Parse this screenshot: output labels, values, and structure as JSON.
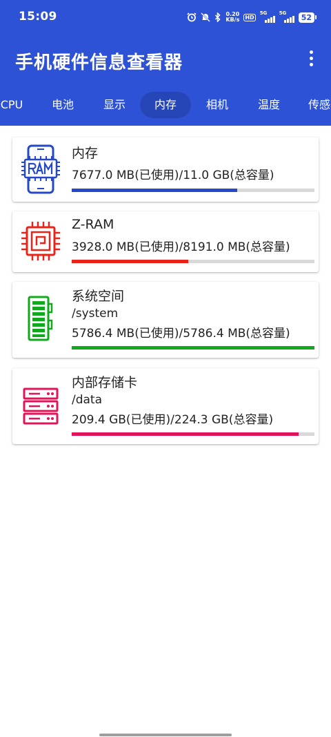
{
  "status_bar": {
    "time": "15:09",
    "net_speed_value": "0.20",
    "net_speed_unit": "KB/s",
    "hd_badge": "HD",
    "signal1_label": "5G",
    "signal2_label": "5G",
    "battery": "52"
  },
  "app": {
    "title": "手机硬件信息查看器"
  },
  "tabs": [
    {
      "label": "CPU",
      "active": false
    },
    {
      "label": "电池",
      "active": false
    },
    {
      "label": "显示",
      "active": false
    },
    {
      "label": "内存",
      "active": true
    },
    {
      "label": "相机",
      "active": false
    },
    {
      "label": "温度",
      "active": false
    },
    {
      "label": "传感器",
      "active": false
    }
  ],
  "cards": [
    {
      "title": "内存",
      "path": "",
      "usage": "7677.0 MB(已使用)/11.0 GB(总容量)",
      "fraction": 0.6816,
      "color": "#2448C8",
      "icon": "ram-phone-icon"
    },
    {
      "title": "Z-RAM",
      "path": "",
      "usage": "3928.0 MB(已使用)/8191.0 MB(总容量)",
      "fraction": 0.4795,
      "color": "#E8241A",
      "icon": "cpu-chip-icon"
    },
    {
      "title": "系统空间",
      "path": "/system",
      "usage": "5786.4 MB(已使用)/5786.4 MB(总容量)",
      "fraction": 1.0,
      "color": "#12A81E",
      "icon": "memory-stick-icon"
    },
    {
      "title": "内部存储卡",
      "path": "/data",
      "usage": "209.4 GB(已使用)/224.3 GB(总容量)",
      "fraction": 0.9336,
      "color": "#E0145A",
      "icon": "server-storage-icon"
    }
  ]
}
